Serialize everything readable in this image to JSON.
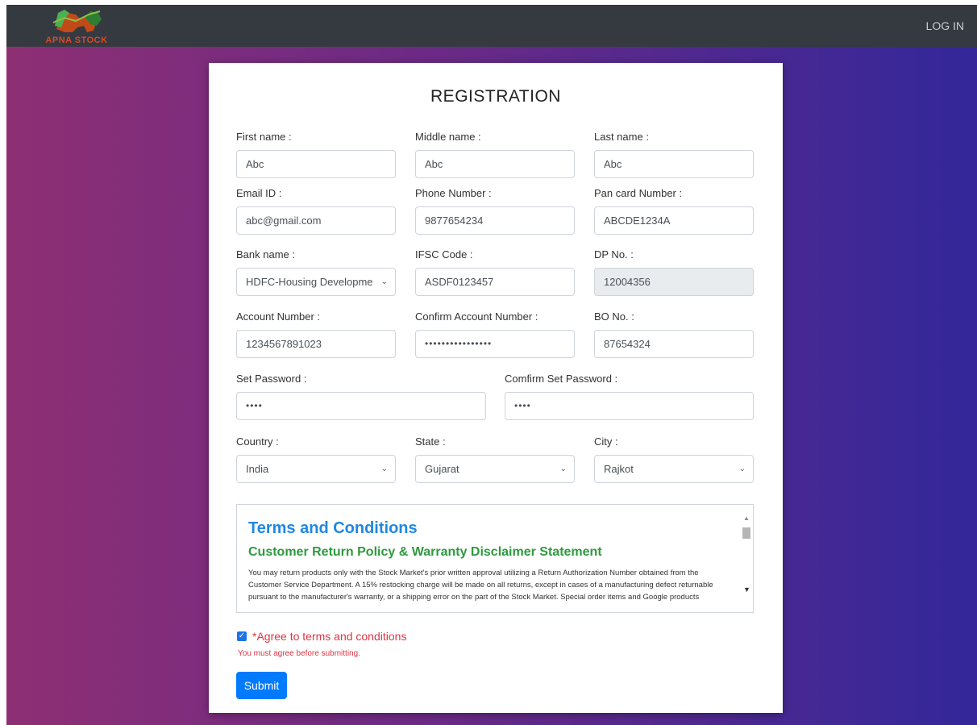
{
  "nav": {
    "brand": "APNA STOCK",
    "login": "LOG IN"
  },
  "form": {
    "title": "REGISTRATION",
    "fields": {
      "first_name": {
        "label": "First name :",
        "value": "Abc"
      },
      "middle_name": {
        "label": "Middle name :",
        "value": "Abc"
      },
      "last_name": {
        "label": "Last name :",
        "value": "Abc"
      },
      "email": {
        "label": "Email ID :",
        "value": "abc@gmail.com"
      },
      "phone": {
        "label": "Phone Number :",
        "value": "9877654234"
      },
      "pan": {
        "label": "Pan card Number :",
        "value": "ABCDE1234A"
      },
      "bank": {
        "label": "Bank name :",
        "value": "HDFC-Housing Developme"
      },
      "ifsc": {
        "label": "IFSC Code :",
        "value": "ASDF0123457"
      },
      "dp": {
        "label": "DP No. :",
        "value": "12004356"
      },
      "account": {
        "label": "Account Number :",
        "value": "1234567891023"
      },
      "confirm_account": {
        "label": "Confirm Account Number :",
        "value": "••••••••••••••••"
      },
      "bo": {
        "label": "BO No. :",
        "value": "87654324"
      },
      "password": {
        "label": "Set Password :",
        "value": "••••"
      },
      "confirm_password": {
        "label": "Comfirm Set Password :",
        "value": "••••"
      },
      "country": {
        "label": "Country :",
        "value": "India"
      },
      "state": {
        "label": "State :",
        "value": "Gujarat"
      },
      "city": {
        "label": "City :",
        "value": "Rajkot"
      }
    },
    "terms": {
      "title": "Terms and Conditions",
      "subtitle": "Customer Return Policy & Warranty Disclaimer Statement",
      "body": "You may return products only with the Stock Market's prior written approval utilizing a Return Authorization Number obtained from the Customer Service Department. A 15% restocking charge will be made on all returns, except in cases of a manufacturing defect returnable pursuant to the manufacturer's warranty, or a shipping error on the part of the Stock Market. Special order items and Google products"
    },
    "agree_label": "*Agree to terms and conditions",
    "agree_error": "You must agree before submitting.",
    "submit_label": "Submit"
  },
  "colors": {
    "primary": "#007bff",
    "error": "#dc3545",
    "terms_title": "#1e88e5",
    "terms_subtitle": "#2e9a3e"
  }
}
